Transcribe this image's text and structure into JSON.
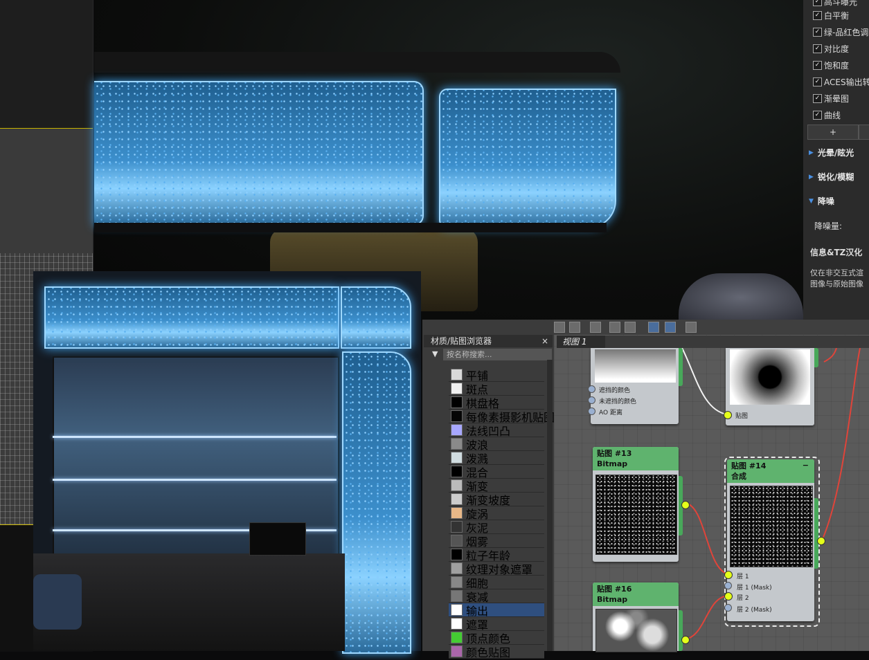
{
  "settings_panel": {
    "checks": [
      {
        "label": "高斗曝光",
        "checked": true
      },
      {
        "label": "白平衡",
        "checked": true
      },
      {
        "label": "绿-品红色调",
        "checked": true
      },
      {
        "label": "对比度",
        "checked": true
      },
      {
        "label": "饱和度",
        "checked": true
      },
      {
        "label": "ACES输出转",
        "checked": true
      },
      {
        "label": "渐晕图",
        "checked": true
      },
      {
        "label": "曲线",
        "checked": true
      }
    ],
    "check_mark": "✓",
    "plus_label": "+",
    "sections": [
      {
        "label": "光晕/眩光",
        "state": "collapsed"
      },
      {
        "label": "锐化/模糊",
        "state": "collapsed"
      },
      {
        "label": "降噪",
        "state": "expanded"
      }
    ],
    "denoise_amount_label": "降噪量:",
    "info_title": "信息&TZ汉化",
    "info_text_1": "仅在非交互式渲",
    "info_text_2": "图像与原始图像"
  },
  "material_browser": {
    "title": "材质/贴图浏览器",
    "close": "×",
    "search_placeholder": "按名称搜索...",
    "items": [
      {
        "label": "平铺",
        "color": "#d9d9d9"
      },
      {
        "label": "斑点",
        "color": "#f0f0f0"
      },
      {
        "label": "棋盘格",
        "color": "#000000"
      },
      {
        "label": "每像素摄影机贴图",
        "color": "#050505"
      },
      {
        "label": "法线凹凸",
        "color": "#a8a8ff"
      },
      {
        "label": "波浪",
        "color": "#8a8a8a"
      },
      {
        "label": "泼溅",
        "color": "#d0dce0"
      },
      {
        "label": "混合",
        "color": "#000000"
      },
      {
        "label": "渐变",
        "color": "#bbbbbb"
      },
      {
        "label": "渐变坡度",
        "color": "#cccccc"
      },
      {
        "label": "旋涡",
        "color": "#e8b888"
      },
      {
        "label": "灰泥",
        "color": "#333333"
      },
      {
        "label": "烟雾",
        "color": "#555555"
      },
      {
        "label": "粒子年龄",
        "color": "#000000"
      },
      {
        "label": "纹理对象遮罩",
        "color": "#a0a0a0"
      },
      {
        "label": "细胞",
        "color": "#888888"
      },
      {
        "label": "衰减",
        "color": "#777777"
      },
      {
        "label": "输出",
        "color": "#ffffff",
        "selected": true
      },
      {
        "label": "遮罩",
        "color": "#ffffff"
      },
      {
        "label": "顶点颜色",
        "color": "#44cc33"
      },
      {
        "label": "颜色贴图",
        "color": "#aa66aa"
      }
    ]
  },
  "node_editor": {
    "view_tab": "视图 1",
    "node_ao": {
      "ports": [
        "遮挡的颜色",
        "未遮挡的颜色",
        "AO 距离"
      ]
    },
    "node_map_port": "贴图",
    "node_13": {
      "title": "贴图 #13",
      "subtitle": "Bitmap"
    },
    "node_14": {
      "title": "贴图 #14",
      "subtitle": "合成",
      "collapse": "−",
      "ports": [
        "层 1",
        "层 1 (Mask)",
        "层 2",
        "层 2 (Mask)"
      ]
    },
    "node_16": {
      "title": "贴图 #16",
      "subtitle": "Bitmap"
    }
  },
  "colors": {
    "accent_blue": "#4a90e2",
    "node_header": "#5fb36e",
    "socket_yellow": "#e4ff1a",
    "wire_red": "#e0443a"
  }
}
